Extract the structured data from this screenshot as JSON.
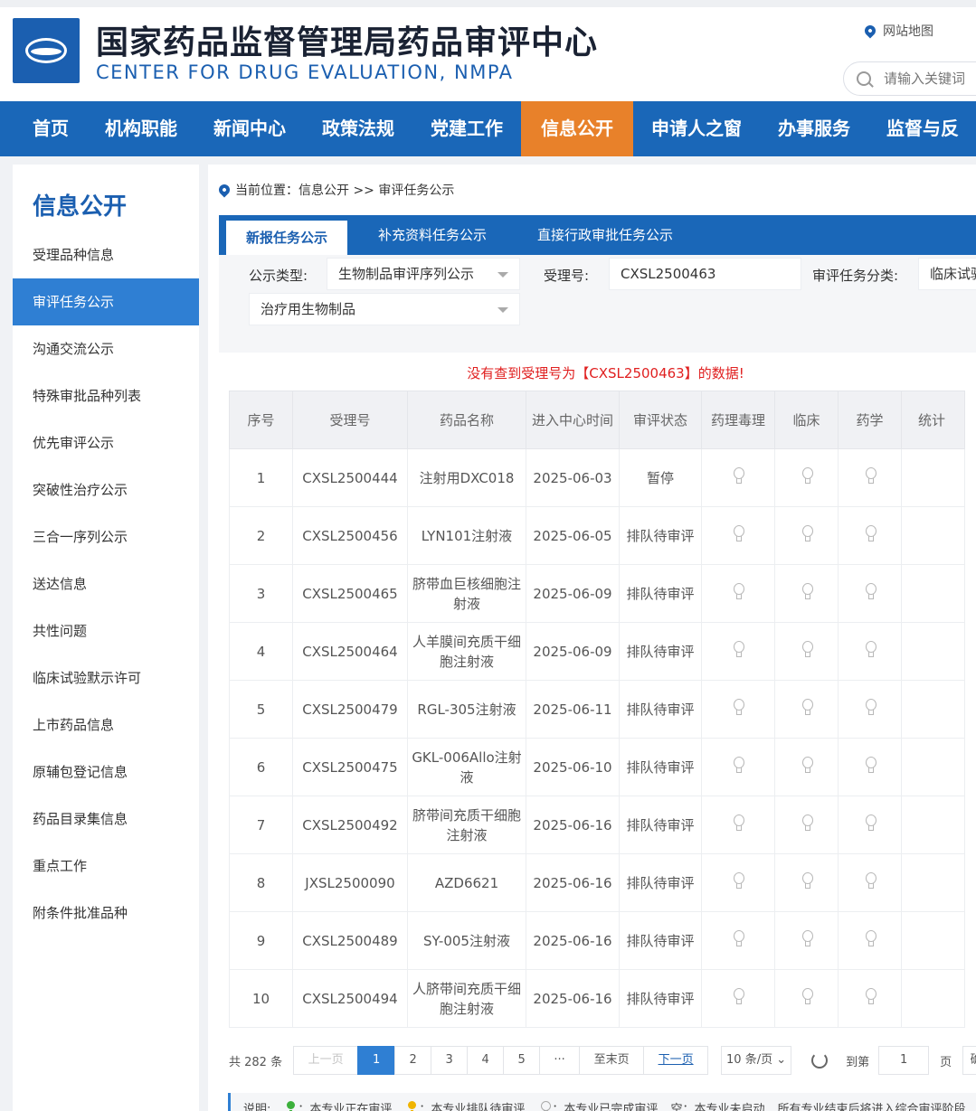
{
  "header": {
    "title_cn": "国家药品监督管理局药品审评中心",
    "title_en": "CENTER FOR DRUG EVALUATION, NMPA",
    "sitemap": "网站地图",
    "search_placeholder": "请输入关键词"
  },
  "nav": [
    "首页",
    "机构职能",
    "新闻中心",
    "政策法规",
    "党建工作",
    "信息公开",
    "申请人之窗",
    "办事服务",
    "监督与反"
  ],
  "sidebar": {
    "title": "信息公开",
    "items": [
      "受理品种信息",
      "审评任务公示",
      "沟通交流公示",
      "特殊审批品种列表",
      "优先审评公示",
      "突破性治疗公示",
      "三合一序列公示",
      "送达信息",
      "共性问题",
      "临床试验默示许可",
      "上市药品信息",
      "原辅包登记信息",
      "药品目录集信息",
      "重点工作",
      "附条件批准品种"
    ]
  },
  "breadcrumb": "当前位置：信息公开 >> 审评任务公示",
  "tabs": [
    "新报任务公示",
    "补充资料任务公示",
    "直接行政审批任务公示"
  ],
  "filter": {
    "type_label": "公示类型:",
    "type_value": "生物制品审评序列公示",
    "accept_label": "受理号:",
    "accept_value": "CXSL2500463",
    "category_label": "审评任务分类:",
    "category_value": "临床试验",
    "subtype_value": "治疗用生物制品"
  },
  "no_data_msg": "没有查到受理号为【CXSL2500463】的数据!",
  "table": {
    "headers": [
      "序号",
      "受理号",
      "药品名称",
      "进入中心时间",
      "审评状态",
      "药理毒理",
      "临床",
      "药学",
      "统计"
    ],
    "rows": [
      [
        "1",
        "CXSL2500444",
        "注射用DXC018",
        "2025-06-03",
        "暂停"
      ],
      [
        "2",
        "CXSL2500456",
        "LYN101注射液",
        "2025-06-05",
        "排队待审评"
      ],
      [
        "3",
        "CXSL2500465",
        "脐带血巨核细胞注射液",
        "2025-06-09",
        "排队待审评"
      ],
      [
        "4",
        "CXSL2500464",
        "人羊膜间充质干细胞注射液",
        "2025-06-09",
        "排队待审评"
      ],
      [
        "5",
        "CXSL2500479",
        "RGL-305注射液",
        "2025-06-11",
        "排队待审评"
      ],
      [
        "6",
        "CXSL2500475",
        "GKL-006Allo注射液",
        "2025-06-10",
        "排队待审评"
      ],
      [
        "7",
        "CXSL2500492",
        "脐带间充质干细胞注射液",
        "2025-06-16",
        "排队待审评"
      ],
      [
        "8",
        "JXSL2500090",
        "AZD6621",
        "2025-06-16",
        "排队待审评"
      ],
      [
        "9",
        "CXSL2500489",
        "SY-005注射液",
        "2025-06-16",
        "排队待审评"
      ],
      [
        "10",
        "CXSL2500494",
        "人脐带间充质干细胞注射液",
        "2025-06-16",
        "排队待审评"
      ]
    ]
  },
  "pager": {
    "total": "共 282 条",
    "prev": "上一页",
    "pages": [
      "1",
      "2",
      "3",
      "4",
      "5"
    ],
    "ellipsis": "···",
    "last": "至末页",
    "next": "下一页",
    "per_page": "10 条/页",
    "goto_label": "到第",
    "goto_value": "1",
    "page_unit": "页",
    "confirm": "确"
  },
  "legend": {
    "label": "说明:",
    "green": "：本专业正在审评",
    "yellow": "：本专业排队待审评",
    "grey": "：本专业已完成审评",
    "empty": "空：本专业未启动",
    "note": "所有专业结束后将进入综合审评阶段"
  },
  "colors": {
    "brand": "#1a67b8",
    "active_nav": "#e8812a",
    "sidebar_active": "#2f7fd3",
    "alert": "#e02020"
  }
}
